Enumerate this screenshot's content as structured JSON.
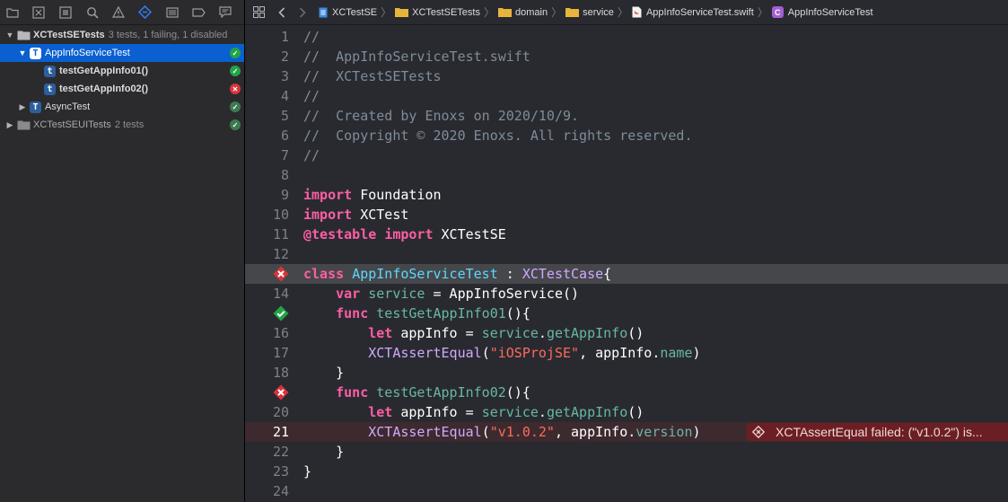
{
  "navigator": {
    "toolbar_icons": [
      "folder-icon",
      "source-control-icon",
      "symbol-icon",
      "search-icon",
      "issue-icon",
      "test-navigator-icon",
      "debug-icon",
      "breakpoint-icon",
      "report-icon"
    ],
    "active_tool": "test-navigator-icon",
    "tree": [
      {
        "label": "XCTestSETests",
        "meta": "3 tests, 1 failing, 1 disabled"
      },
      {
        "label": "AppInfoServiceTest",
        "status": "pass"
      },
      {
        "label": "testGetAppInfo01()",
        "status": "pass"
      },
      {
        "label": "testGetAppInfo02()",
        "status": "fail"
      },
      {
        "label": "AsyncTest",
        "status": "pass"
      },
      {
        "label": "XCTestSEUITests",
        "meta": "2 tests",
        "status": "pass"
      }
    ]
  },
  "jumpbar": {
    "crumbs": [
      "XCTestSE",
      "XCTestSETests",
      "domain",
      "service",
      "AppInfoServiceTest.swift",
      "AppInfoServiceTest"
    ],
    "class_badge": "C"
  },
  "editor": {
    "line_numbers": [
      "1",
      "2",
      "3",
      "4",
      "5",
      "6",
      "7",
      "8",
      "9",
      "10",
      "11",
      "12",
      "13",
      "14",
      "15",
      "16",
      "17",
      "18",
      "19",
      "20",
      "21",
      "22",
      "23",
      "24"
    ],
    "lines": [
      [
        {
          "t": "//",
          "c": "com"
        }
      ],
      [
        {
          "t": "//  AppInfoServiceTest.swift",
          "c": "com"
        }
      ],
      [
        {
          "t": "//  XCTestSETests",
          "c": "com"
        }
      ],
      [
        {
          "t": "//",
          "c": "com"
        }
      ],
      [
        {
          "t": "//  Created by Enoxs on 2020/10/9.",
          "c": "com"
        }
      ],
      [
        {
          "t": "//  Copyright © 2020 Enoxs. All rights reserved.",
          "c": "com"
        }
      ],
      [
        {
          "t": "//",
          "c": "com"
        }
      ],
      [],
      [
        {
          "t": "import",
          "c": "kw"
        },
        {
          "t": " Foundation",
          "c": "pl"
        }
      ],
      [
        {
          "t": "import",
          "c": "kw"
        },
        {
          "t": " XCTest",
          "c": "pl"
        }
      ],
      [
        {
          "t": "@testable",
          "c": "kw"
        },
        {
          "t": " ",
          "c": "pl"
        },
        {
          "t": "import",
          "c": "kw"
        },
        {
          "t": " XCTestSE",
          "c": "pl"
        }
      ],
      [],
      [
        {
          "t": "class",
          "c": "kw"
        },
        {
          "t": " ",
          "c": "pl"
        },
        {
          "t": "AppInfoServiceTest",
          "c": "type"
        },
        {
          "t": " : ",
          "c": "pl"
        },
        {
          "t": "XCTestCase",
          "c": "cls"
        },
        {
          "t": "{",
          "c": "pl"
        }
      ],
      [
        {
          "t": "    ",
          "c": "pl"
        },
        {
          "t": "var",
          "c": "kw"
        },
        {
          "t": " ",
          "c": "pl"
        },
        {
          "t": "service",
          "c": "fn"
        },
        {
          "t": " = AppInfoService()",
          "c": "pl"
        }
      ],
      [
        {
          "t": "    ",
          "c": "pl"
        },
        {
          "t": "func",
          "c": "kw"
        },
        {
          "t": " ",
          "c": "pl"
        },
        {
          "t": "testGetAppInfo01",
          "c": "fn"
        },
        {
          "t": "(){",
          "c": "pl"
        }
      ],
      [
        {
          "t": "        ",
          "c": "pl"
        },
        {
          "t": "let",
          "c": "kw"
        },
        {
          "t": " appInfo = ",
          "c": "pl"
        },
        {
          "t": "service",
          "c": "prop"
        },
        {
          "t": ".",
          "c": "pl"
        },
        {
          "t": "getAppInfo",
          "c": "prop"
        },
        {
          "t": "()",
          "c": "pl"
        }
      ],
      [
        {
          "t": "        ",
          "c": "pl"
        },
        {
          "t": "XCTAssertEqual",
          "c": "cls"
        },
        {
          "t": "(",
          "c": "pl"
        },
        {
          "t": "\"iOSProjSE\"",
          "c": "str"
        },
        {
          "t": ", appInfo.",
          "c": "pl"
        },
        {
          "t": "name",
          "c": "prop"
        },
        {
          "t": ")",
          "c": "pl"
        }
      ],
      [
        {
          "t": "    }",
          "c": "pl"
        }
      ],
      [
        {
          "t": "    ",
          "c": "pl"
        },
        {
          "t": "func",
          "c": "kw"
        },
        {
          "t": " ",
          "c": "pl"
        },
        {
          "t": "testGetAppInfo02",
          "c": "fn"
        },
        {
          "t": "(){",
          "c": "pl"
        }
      ],
      [
        {
          "t": "        ",
          "c": "pl"
        },
        {
          "t": "let",
          "c": "kw"
        },
        {
          "t": " appInfo = ",
          "c": "pl"
        },
        {
          "t": "service",
          "c": "prop"
        },
        {
          "t": ".",
          "c": "pl"
        },
        {
          "t": "getAppInfo",
          "c": "prop"
        },
        {
          "t": "()",
          "c": "pl"
        }
      ],
      [
        {
          "t": "        ",
          "c": "pl"
        },
        {
          "t": "XCTAssertEqual",
          "c": "cls"
        },
        {
          "t": "(",
          "c": "pl"
        },
        {
          "t": "\"v1.0.2\"",
          "c": "str"
        },
        {
          "t": ", appInfo.",
          "c": "pl"
        },
        {
          "t": "version",
          "c": "prop"
        },
        {
          "t": ")",
          "c": "pl"
        }
      ],
      [
        {
          "t": "    }",
          "c": "pl"
        }
      ],
      [
        {
          "t": "}",
          "c": "pl"
        }
      ],
      []
    ],
    "highlighted_line": "13",
    "error_line": "21",
    "gutter_markers": [
      {
        "line": "13",
        "type": "fail"
      },
      {
        "line": "15",
        "type": "pass"
      },
      {
        "line": "19",
        "type": "fail"
      }
    ],
    "error_message": "XCTAssertEqual failed: (\"v1.0.2\") is..."
  },
  "colors": {
    "keyword": "#fc5fa3",
    "type": "#5dd8ff",
    "class": "#d0a8ff",
    "function": "#67b7a4",
    "string": "#fc6a5d",
    "comment": "#7f8c98",
    "selection": "#0a60d0",
    "fail": "#d9343b",
    "pass": "#22a447"
  }
}
